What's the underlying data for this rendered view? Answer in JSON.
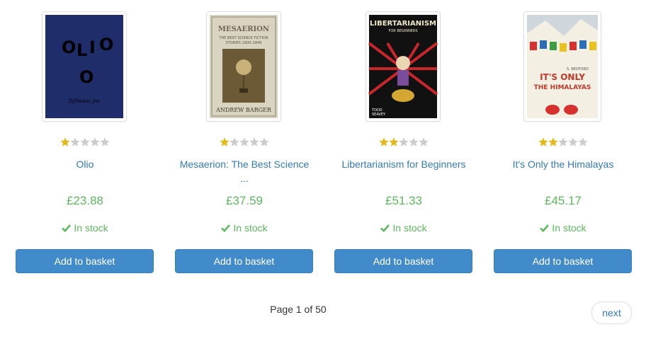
{
  "products": [
    {
      "title": "Olio",
      "price": "£23.88",
      "rating": 1,
      "availability": "In stock",
      "button_label": "Add to basket",
      "cover": {
        "bg": "#1f2d6b",
        "lines": [
          "O L I O",
          "O"
        ],
        "author": "Djfhkdsa Jns"
      }
    },
    {
      "title": "Mesaerion: The Best Science ...",
      "price": "£37.59",
      "rating": 1,
      "availability": "In stock",
      "button_label": "Add to basket",
      "cover": {
        "bg": "#d9d4c2",
        "lines": [
          "MESAERION",
          "The Best Science Fiction",
          "Stories 1800–1849"
        ],
        "author": "ANDREW BARGER"
      }
    },
    {
      "title": "Libertarianism for Beginners",
      "price": "£51.33",
      "rating": 2,
      "availability": "In stock",
      "button_label": "Add to basket",
      "cover": {
        "bg": "#111111",
        "lines": [
          "LIBERTARIANISM",
          "FOR BEGINNERS"
        ],
        "author": "TODD SEAVEY"
      }
    },
    {
      "title": "It's Only the Himalayas",
      "price": "£45.17",
      "rating": 2,
      "availability": "In stock",
      "button_label": "Add to basket",
      "cover": {
        "bg": "#f3efe2",
        "lines": [
          "IT'S ONLY",
          "THE HIMALAYAS"
        ],
        "author": "S. BEDFORD"
      }
    }
  ],
  "pager": {
    "current": "Page 1 of 50",
    "next_label": "next"
  },
  "colors": {
    "link": "#337ab7",
    "price": "#5cb85c",
    "button": "#428bca",
    "star_on": "#e5b819",
    "star_off": "#cccccc"
  },
  "icons": {
    "star": "star-icon",
    "check": "check-icon"
  }
}
